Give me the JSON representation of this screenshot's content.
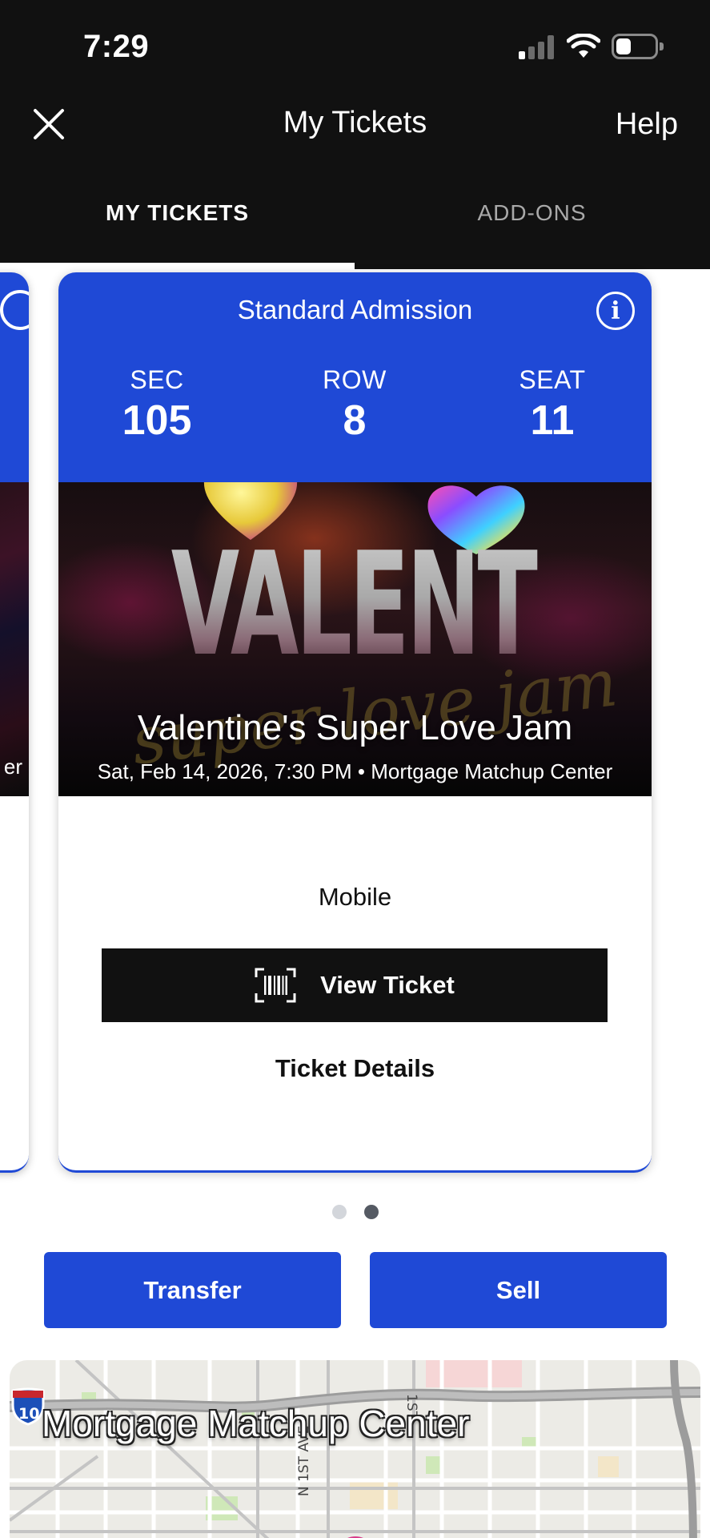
{
  "status_bar": {
    "time": "7:29",
    "signal_bars_active": 1,
    "signal_bars_total": 4,
    "battery_level_fraction": 0.3
  },
  "nav": {
    "title": "My Tickets",
    "help_label": "Help",
    "close_icon": "close-icon"
  },
  "tabs": [
    {
      "label": "MY TICKETS",
      "selected": true
    },
    {
      "label": "ADD-ONS",
      "selected": false
    }
  ],
  "previous_card": {
    "meta_tail": "er"
  },
  "ticket": {
    "type": "Standard Admission",
    "info_icon": "info-icon",
    "section_label": "SEC",
    "section": "105",
    "row_label": "ROW",
    "row": "8",
    "seat_label": "SEAT",
    "seat": "11",
    "artwork": {
      "headline": "VALENTINES",
      "script": "super love jam"
    },
    "event_name": "Valentine's Super Love Jam",
    "event_meta": "Sat, Feb 14, 2026, 7:30 PM • Mortgage Matchup Center",
    "delivery_method": "Mobile",
    "view_ticket_label": "View Ticket",
    "view_ticket_icon": "barcode-scan-icon",
    "details_label": "Ticket Details"
  },
  "carousel": {
    "page_count": 2,
    "active_index": 1
  },
  "actions": {
    "transfer_label": "Transfer",
    "sell_label": "Sell"
  },
  "map": {
    "venue_name": "Mortgage Matchup Center",
    "interstate_shield": "10",
    "street_labels": [
      "N 1ST AVE",
      "1ST"
    ]
  },
  "colors": {
    "primary_blue": "#1f49d6",
    "header_black": "#111111",
    "white": "#ffffff"
  }
}
